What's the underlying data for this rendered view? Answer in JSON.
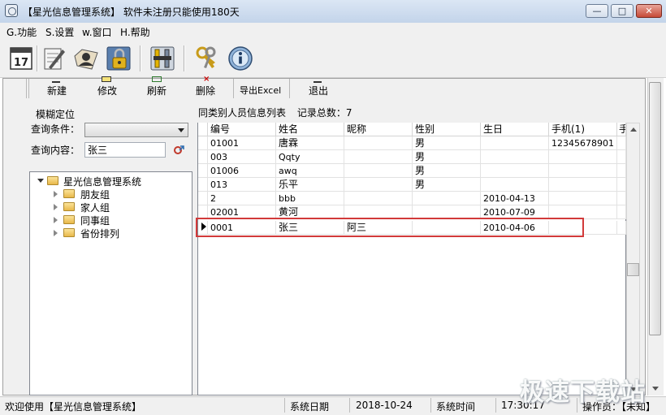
{
  "window": {
    "title": "【星光信息管理系统】 软件未注册只能使用180天",
    "min_glyph": "—",
    "max_glyph": "□",
    "close_glyph": "✕"
  },
  "menu": [
    "G.功能",
    "S.设置",
    "w.窗口",
    "H.帮助"
  ],
  "toolbar_icons": [
    "calendar-icon",
    "notepad-icon",
    "contacts-icon",
    "lock-icon",
    "tools-icon",
    "keys-icon",
    "info-icon"
  ],
  "calendar_day": "17",
  "subtoolbar": [
    "新建",
    "修改",
    "刷新",
    "删除",
    "导出Excel",
    "退出"
  ],
  "search": {
    "group_label": "模糊定位",
    "cond_label": "查询条件：",
    "cond_value": "",
    "content_label": "查询内容：",
    "content_value": "张三"
  },
  "tree": {
    "root": "星光信息管理系统",
    "children": [
      "朋友组",
      "家人组",
      "同事组",
      "省份排列"
    ]
  },
  "grid": {
    "title": "同类别人员信息列表",
    "count_label": "记录总数：7",
    "columns": [
      "编号",
      "姓名",
      "昵称",
      "性别",
      "生日",
      "手机(1)",
      "手"
    ],
    "rows": [
      [
        "01001",
        "唐霖",
        "",
        "男",
        "",
        "12345678901"
      ],
      [
        "003",
        "Qqty",
        "",
        "男",
        "",
        ""
      ],
      [
        "01006",
        "awq",
        "",
        "男",
        "",
        ""
      ],
      [
        "013",
        "乐平",
        "",
        "男",
        "",
        ""
      ],
      [
        "2",
        "bbb",
        "",
        "",
        "2010-04-13",
        ""
      ],
      [
        "02001",
        "黄河",
        "",
        "",
        "2010-07-09",
        ""
      ],
      [
        "0001",
        "张三",
        "阿三",
        "",
        "2010-04-06",
        ""
      ]
    ],
    "selected_row": 6
  },
  "status": {
    "welcome": "欢迎使用【星光信息管理系统】",
    "date_label": "系统日期",
    "date_value": "2018-10-24",
    "time_label": "系统时间",
    "time_value": "17:30:17",
    "operator": "操作员：【未知】"
  },
  "watermark": "极速下载站"
}
